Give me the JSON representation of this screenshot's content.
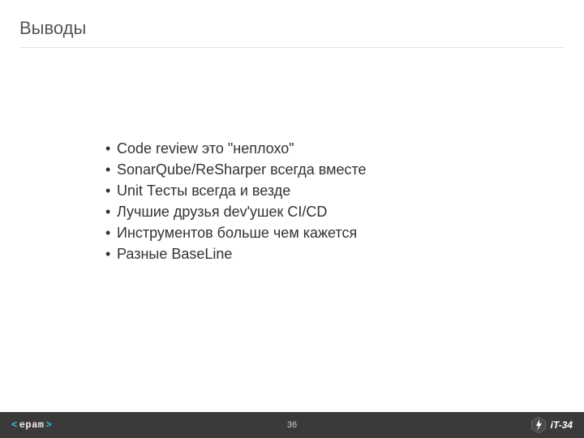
{
  "title": "Выводы",
  "bullets": [
    "Code review это \"неплохо\"",
    "SonarQube/ReSharper всегда вместе",
    "Unit Тесты всегда и везде",
    "Лучшие друзья dev'ушек CI/CD",
    "Инструментов больше чем кажется",
    "Разные BaseLine"
  ],
  "footer": {
    "left_angle_open": "<",
    "left_brand": "epam",
    "left_angle_close": ">",
    "page": "36",
    "right_label": "iT-34"
  }
}
